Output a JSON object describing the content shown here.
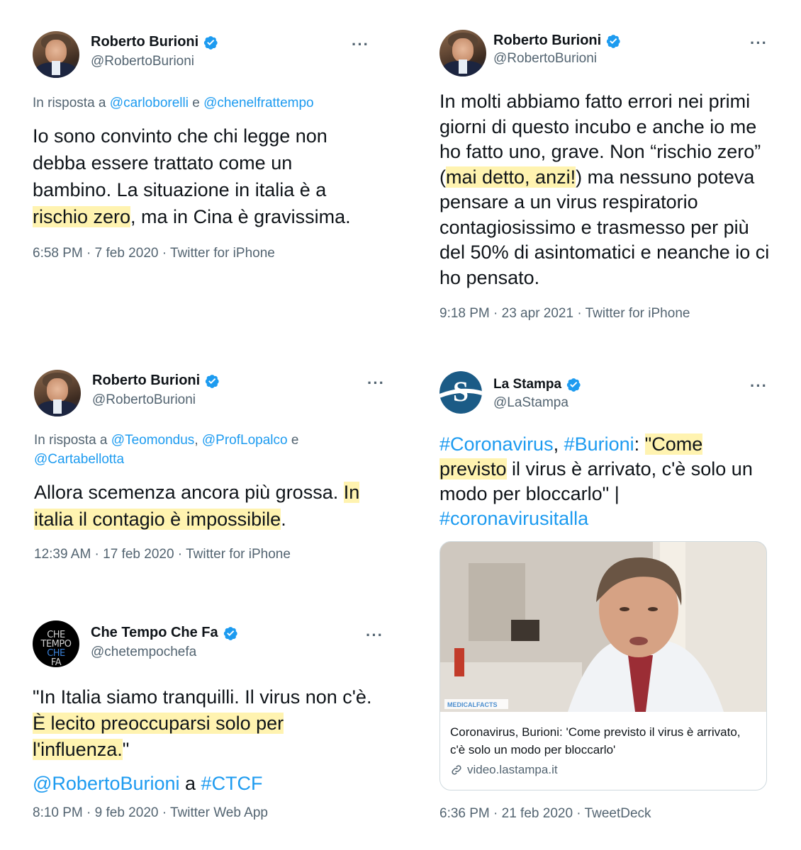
{
  "tweets": [
    {
      "name": "Roberto Burioni",
      "handle": "@RobertoBurioni",
      "more": "···",
      "reply_prefix": "In risposta a ",
      "reply_user1": "@carloborelli",
      "reply_sep": " e ",
      "reply_user2": "@chenelfrattempo",
      "body_1": "Io sono convinto che chi legge non debba essere trattato come un bambino. La situazione in italia è a ",
      "body_hl": "rischio zero",
      "body_2": ", ma in Cina è gravissima.",
      "meta": "6:58 PM · 7 feb 2020 · Twitter for iPhone"
    },
    {
      "name": "Roberto Burioni",
      "handle": "@RobertoBurioni",
      "more": "···",
      "body_1": "In molti abbiamo fatto errori nei primi giorni di questo incubo e anche io me ho fatto uno, grave. Non “rischio zero” (",
      "body_hl": "mai detto, anzi!",
      "body_2": ") ma nessuno poteva pensare a un virus respiratorio contagiosissimo e trasmesso per più del 50% di asintomatici e neanche io ci ho pensato.",
      "meta": "9:18 PM · 23 apr 2021 · Twitter for iPhone"
    },
    {
      "name": "Roberto Burioni",
      "handle": "@RobertoBurioni",
      "more": "···",
      "reply_prefix": "In risposta a ",
      "reply_user1": "@Teomondus",
      "reply_sep": ", ",
      "reply_user2": "@ProfLopalco",
      "reply_sep2": " e ",
      "reply_user3": "@Cartabellotta",
      "body_1": "Allora scemenza ancora più grossa. ",
      "body_hl": "In italia il contagio è impossibile",
      "body_2": ".",
      "meta": "12:39 AM · 17 feb 2020 · Twitter for iPhone"
    },
    {
      "name": "La Stampa",
      "handle": "@LaStampa",
      "more": "···",
      "tag1": "#Coronavirus",
      "sep1": ", ",
      "tag2": "#Burioni",
      "colon": ": ",
      "body_hl": "\"Come previsto",
      "body_2": " il virus è arrivato, c'è solo un modo per bloccarlo\" | ",
      "tag3": "#coronavirusitalla",
      "card_caption": "Coronavirus, Burioni: 'Come previsto il virus è arrivato, c'è solo un modo per bloccarlo'",
      "card_domain": "video.lastampa.it",
      "card_logo": "MEDICALFACTS",
      "meta": "6:36 PM · 21 feb 2020 · TweetDeck"
    },
    {
      "name": "Che Tempo Che Fa",
      "handle": "@chetempochefa",
      "more": "···",
      "avatar_lines": [
        "CHE",
        "TEMPO",
        "CHE",
        "FA"
      ],
      "body_1": "\"In Italia siamo tranquilli. Il virus non c'è. ",
      "body_hl": "È lecito preoccuparsi solo per l'influenza.",
      "body_2": "\"",
      "mention": "@RobertoBurioni",
      "mention_sep": " a ",
      "tag": "#CTCF",
      "meta": "8:10 PM · 9 feb 2020 · Twitter Web App"
    }
  ],
  "colors": {
    "link": "#1d9bf0",
    "highlight": "#fff3b0",
    "verified": "#1d9bf0",
    "secondary": "#536471"
  },
  "icons": [
    "verified-badge-icon",
    "more-options-icon",
    "link-icon"
  ]
}
